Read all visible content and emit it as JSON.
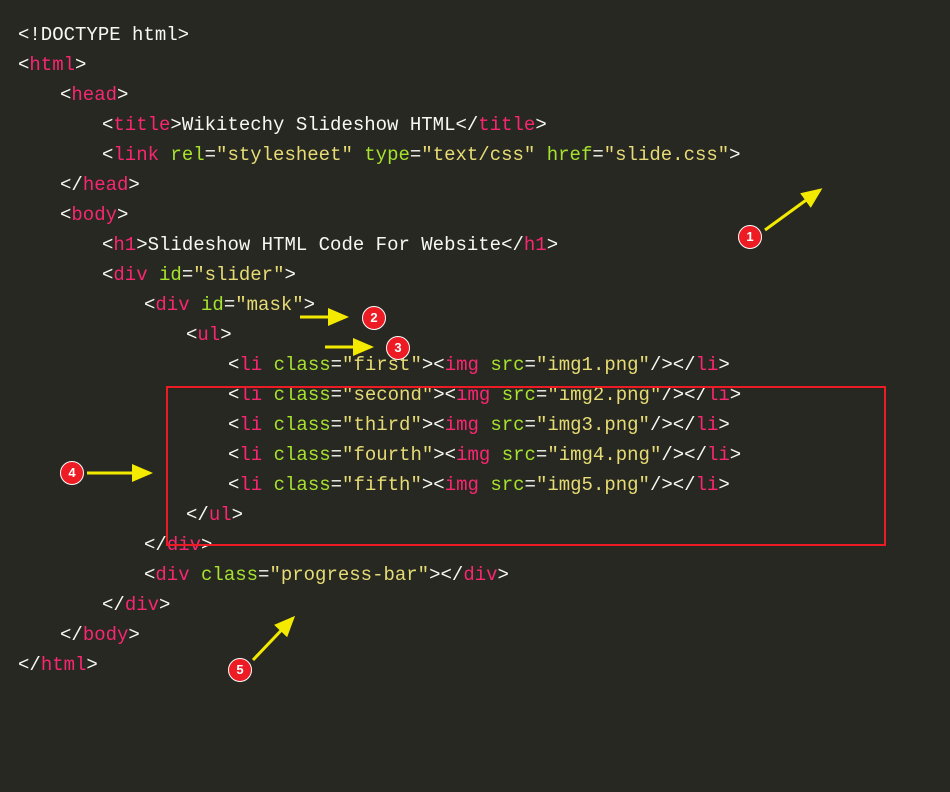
{
  "code": {
    "doctype": "<!DOCTYPE html>",
    "html_open": "html",
    "head_open": "head",
    "title_open": "title",
    "title_text": "Wikitechy Slideshow HTML",
    "link_tag": "link",
    "link_rel_attr": "rel",
    "link_rel_val": "\"stylesheet\"",
    "link_type_attr": "type",
    "link_type_val": "\"text/css\"",
    "link_href_attr": "href",
    "link_href_val": "\"slide.css\"",
    "head_close": "head",
    "body_open": "body",
    "h1_open": "h1",
    "h1_text": "Slideshow HTML Code For Website",
    "div_tag": "div",
    "id_attr": "id",
    "slider_val": "\"slider\"",
    "mask_val": "\"mask\"",
    "ul_tag": "ul",
    "li_tag": "li",
    "class_attr": "class",
    "img_tag": "img",
    "src_attr": "src",
    "li1_class": "\"first\"",
    "li1_src": "\"img1.png\"",
    "li2_class": "\"second\"",
    "li2_src": "\"img2.png\"",
    "li3_class": "\"third\"",
    "li3_src": "\"img3.png\"",
    "li4_class": "\"fourth\"",
    "li4_src": "\"img4.png\"",
    "li5_class": "\"fifth\"",
    "li5_src": "\"img5.png\"",
    "progress_val": "\"progress-bar\"",
    "body_close": "body",
    "html_close": "html"
  },
  "markers": {
    "m1": "1",
    "m2": "2",
    "m3": "3",
    "m4": "4",
    "m5": "5"
  }
}
